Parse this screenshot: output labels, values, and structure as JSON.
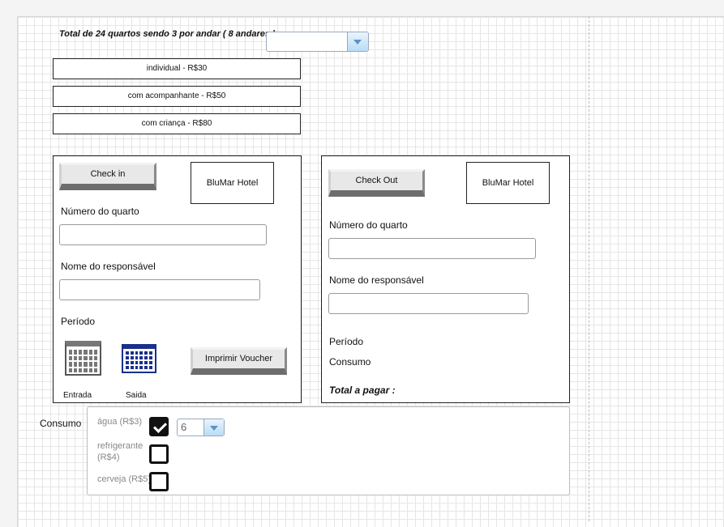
{
  "header": {
    "title": "Total de 24 quartos sendo 3 por andar ( 8 andares )",
    "floor_select_value": ""
  },
  "rates": [
    "individual - R$30",
    "com acompanhante - R$50",
    "com criança - R$80"
  ],
  "checkin": {
    "button_label": "Check in",
    "brand": "BluMar Hotel",
    "room_label": "Número do quarto",
    "room_value": "",
    "name_label": "Nome do responsável",
    "name_value": "",
    "period_label": "Período",
    "entry_label": "Entrada",
    "exit_label": "Saida",
    "voucher_label": "Imprimir Voucher",
    "calendar_entry_icon": "calendar-icon",
    "calendar_exit_icon": "calendar-icon",
    "calendar_exit_color": "#1a2f8a"
  },
  "checkout": {
    "button_label": "Check Out",
    "brand": "BluMar Hotel",
    "room_label": "Número do quarto",
    "room_value": "",
    "name_label": "Nome do responsável",
    "name_value": "",
    "period_label": "Período",
    "consumo_label": "Consumo",
    "total_label": "Total a pagar :"
  },
  "consumo": {
    "label": "Consumo",
    "items": [
      {
        "label": "água (R$3)",
        "checked": true
      },
      {
        "label": "refrigerante (R$4)",
        "checked": false
      },
      {
        "label": "cerveja (R$5)",
        "checked": false
      }
    ],
    "quantity": "6"
  }
}
